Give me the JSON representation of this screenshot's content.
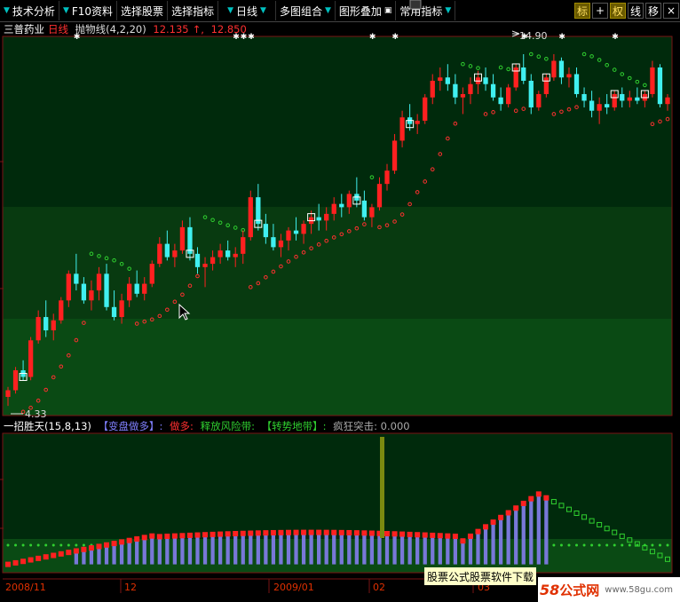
{
  "toolbar": {
    "menus": [
      {
        "label": "技术分析",
        "arrow_left": true
      },
      {
        "label": "F10资料",
        "arrow_left": true
      },
      {
        "label": "选择股票",
        "arrow_left": false
      },
      {
        "label": "选择指标",
        "arrow_left": false
      },
      {
        "label": "日线",
        "arrow_left": true
      },
      {
        "label": "多图组合",
        "arrow_left": true
      },
      {
        "label": "图形叠加",
        "arrow_left": false
      },
      {
        "label": "常用指标",
        "arrow_left": false
      }
    ],
    "buttons": [
      "标",
      "+",
      "权",
      "线",
      "移",
      "×"
    ]
  },
  "main_info": {
    "stock_name": "三普药业",
    "period": "日线",
    "indicator": "抛物线(4,2,20)",
    "value1": "12.135",
    "value2": "12.850"
  },
  "sub_info": {
    "name": "一招胜天(15,8,13)",
    "item1": "【变盘做多】:",
    "item2": "做多:",
    "item3": "释放风险带:",
    "item4": "【转势地带】:",
    "item5": "疯狂突击: 0.000"
  },
  "annotations": {
    "high": "14.90",
    "low": "4.33"
  },
  "x_axis": [
    "2008/11",
    "12",
    "2009/01",
    "02",
    "03"
  ],
  "watermark": {
    "box": "股票公式股票软件下载",
    "logo_num": "58",
    "logo_text": "公式网",
    "url": "www.58gu.com"
  },
  "colors": {
    "up": "#ff2020",
    "down": "#40f0f0",
    "sar_up": "#ff3030",
    "sar_down": "#30d030",
    "bar_blue": "#7878d8"
  },
  "chart_data": {
    "type": "candlestick",
    "candles": [
      [
        4.6,
        4.9,
        4.33,
        4.8
      ],
      [
        4.8,
        5.5,
        4.7,
        5.4
      ],
      [
        5.4,
        5.7,
        5.1,
        5.2
      ],
      [
        5.2,
        6.4,
        5.1,
        6.3
      ],
      [
        6.3,
        7.2,
        6.2,
        7.0
      ],
      [
        7.0,
        7.5,
        6.4,
        6.6
      ],
      [
        6.6,
        7.1,
        6.3,
        6.9
      ],
      [
        6.9,
        7.6,
        6.8,
        7.5
      ],
      [
        7.5,
        8.4,
        7.3,
        8.3
      ],
      [
        8.3,
        8.9,
        7.8,
        8.0
      ],
      [
        8.0,
        8.2,
        7.4,
        7.5
      ],
      [
        7.5,
        8.1,
        7.2,
        7.8
      ],
      [
        7.8,
        8.5,
        7.5,
        8.3
      ],
      [
        8.3,
        8.6,
        7.2,
        7.3
      ],
      [
        7.3,
        7.8,
        6.9,
        7.0
      ],
      [
        7.0,
        7.7,
        6.8,
        7.5
      ],
      [
        7.5,
        8.2,
        7.3,
        8.0
      ],
      [
        8.0,
        8.4,
        7.6,
        7.7
      ],
      [
        7.7,
        8.2,
        7.5,
        8.0
      ],
      [
        8.0,
        8.7,
        7.9,
        8.6
      ],
      [
        8.6,
        9.4,
        8.5,
        9.2
      ],
      [
        9.2,
        9.6,
        8.7,
        8.8
      ],
      [
        8.8,
        9.2,
        8.5,
        9.0
      ],
      [
        9.0,
        9.9,
        8.9,
        9.7
      ],
      [
        9.7,
        10.0,
        8.7,
        8.9
      ],
      [
        8.9,
        9.1,
        8.3,
        8.5
      ],
      [
        8.5,
        8.8,
        7.9,
        8.6
      ],
      [
        8.6,
        9.0,
        8.4,
        8.8
      ],
      [
        8.8,
        9.2,
        8.6,
        9.0
      ],
      [
        9.0,
        9.3,
        8.7,
        8.8
      ],
      [
        8.8,
        9.1,
        8.5,
        8.9
      ],
      [
        8.9,
        9.6,
        8.6,
        9.4
      ],
      [
        9.4,
        10.8,
        9.3,
        10.6
      ],
      [
        10.6,
        11.0,
        9.6,
        9.8
      ],
      [
        9.8,
        10.1,
        9.2,
        9.4
      ],
      [
        9.4,
        9.8,
        9.0,
        9.1
      ],
      [
        9.1,
        9.5,
        8.8,
        9.3
      ],
      [
        9.3,
        9.7,
        9.0,
        9.6
      ],
      [
        9.6,
        10.0,
        9.3,
        9.5
      ],
      [
        9.5,
        9.9,
        9.2,
        9.8
      ],
      [
        9.8,
        10.2,
        9.5,
        10.0
      ],
      [
        10.0,
        10.4,
        9.6,
        9.9
      ],
      [
        9.9,
        10.3,
        9.6,
        10.1
      ],
      [
        10.1,
        10.6,
        9.9,
        10.4
      ],
      [
        10.4,
        10.7,
        10.0,
        10.3
      ],
      [
        10.3,
        10.8,
        10.1,
        10.7
      ],
      [
        10.7,
        11.2,
        10.3,
        10.5
      ],
      [
        10.5,
        10.8,
        9.9,
        10.0
      ],
      [
        10.0,
        10.4,
        9.7,
        10.3
      ],
      [
        10.3,
        11.2,
        10.2,
        11.0
      ],
      [
        11.0,
        11.6,
        10.8,
        11.4
      ],
      [
        11.4,
        12.5,
        11.3,
        12.3
      ],
      [
        12.3,
        13.2,
        12.1,
        13.0
      ],
      [
        13.0,
        13.4,
        12.6,
        12.8
      ],
      [
        12.8,
        13.1,
        12.5,
        12.9
      ],
      [
        12.9,
        13.7,
        12.8,
        13.6
      ],
      [
        13.6,
        14.3,
        13.4,
        14.1
      ],
      [
        14.1,
        14.5,
        13.8,
        14.2
      ],
      [
        14.2,
        14.6,
        13.8,
        14.0
      ],
      [
        14.0,
        14.3,
        13.4,
        13.6
      ],
      [
        13.6,
        13.9,
        13.1,
        13.7
      ],
      [
        13.7,
        14.2,
        13.4,
        14.0
      ],
      [
        14.0,
        14.4,
        13.7,
        14.2
      ],
      [
        14.2,
        14.5,
        13.8,
        14.0
      ],
      [
        14.0,
        14.3,
        13.5,
        13.6
      ],
      [
        13.6,
        13.9,
        13.2,
        13.4
      ],
      [
        13.4,
        14.0,
        13.3,
        13.9
      ],
      [
        13.9,
        14.6,
        13.8,
        14.5
      ],
      [
        14.5,
        14.9,
        14.0,
        14.1
      ],
      [
        14.1,
        14.3,
        13.1,
        13.3
      ],
      [
        13.3,
        13.8,
        13.2,
        13.7
      ],
      [
        13.7,
        14.3,
        13.6,
        14.2
      ],
      [
        14.2,
        14.9,
        14.1,
        14.7
      ],
      [
        14.7,
        14.8,
        14.0,
        14.2
      ],
      [
        14.2,
        14.5,
        13.9,
        14.3
      ],
      [
        14.3,
        14.5,
        13.6,
        13.7
      ],
      [
        13.7,
        13.9,
        13.3,
        13.5
      ],
      [
        13.5,
        13.8,
        13.0,
        13.2
      ],
      [
        13.2,
        13.6,
        12.8,
        13.4
      ],
      [
        13.4,
        13.7,
        13.1,
        13.3
      ],
      [
        13.3,
        13.8,
        13.2,
        13.7
      ],
      [
        13.7,
        13.9,
        13.3,
        13.5
      ],
      [
        13.5,
        13.8,
        13.3,
        13.6
      ],
      [
        13.6,
        13.9,
        13.4,
        13.5
      ],
      [
        13.5,
        13.8,
        13.3,
        13.7
      ],
      [
        13.7,
        14.7,
        13.6,
        14.5
      ],
      [
        14.5,
        14.6,
        13.3,
        13.4
      ],
      [
        13.4,
        13.7,
        13.2,
        13.6
      ]
    ]
  }
}
